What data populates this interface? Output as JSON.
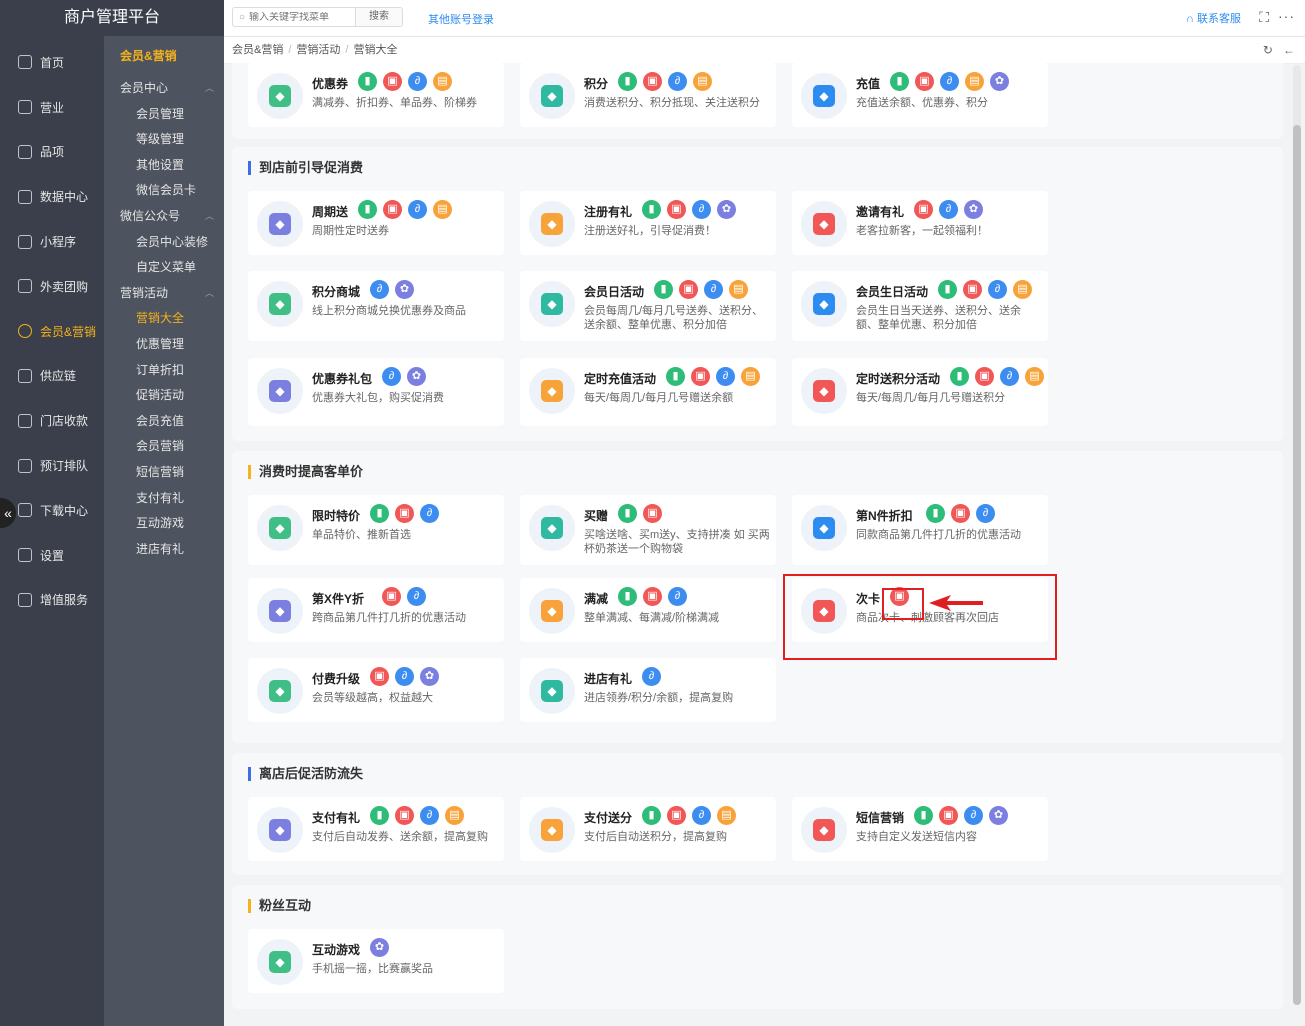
{
  "app_title": "商户管理平台",
  "nav1": [
    {
      "label": "首页",
      "icon": "home-icon"
    },
    {
      "label": "营业",
      "icon": "store-icon"
    },
    {
      "label": "品项",
      "icon": "product-icon"
    },
    {
      "label": "数据中心",
      "icon": "data-icon"
    },
    {
      "label": "小程序",
      "icon": "miniprogram-icon"
    },
    {
      "label": "外卖团购",
      "icon": "delivery-icon"
    },
    {
      "label": "会员&营销",
      "icon": "member-icon",
      "active": true
    },
    {
      "label": "供应链",
      "icon": "supply-icon"
    },
    {
      "label": "门店收款",
      "icon": "payment-icon"
    },
    {
      "label": "预订排队",
      "icon": "queue-icon"
    },
    {
      "label": "下载中心",
      "icon": "download-icon"
    },
    {
      "label": "设置",
      "icon": "settings-icon"
    },
    {
      "label": "增值服务",
      "icon": "value-service-icon"
    }
  ],
  "sidebar2": {
    "head": "会员&营销",
    "groups": [
      {
        "label": "会员中心",
        "items": [
          "会员管理",
          "等级管理",
          "其他设置",
          "微信会员卡"
        ]
      },
      {
        "label": "微信公众号",
        "items": [
          "会员中心装修",
          "自定义菜单"
        ]
      },
      {
        "label": "营销活动",
        "items": [
          "营销大全",
          "优惠管理",
          "订单折扣",
          "促销活动",
          "会员充值",
          "会员营销",
          "短信营销",
          "支付有礼",
          "互动游戏",
          "进店有礼"
        ]
      }
    ],
    "active_item": "营销大全"
  },
  "topbar": {
    "search_placeholder": "输入关键字找菜单",
    "search_button": "搜索",
    "other_login": "其他账号登录",
    "contact": "联系客服"
  },
  "breadcrumb": [
    "会员&营销",
    "营销活动",
    "营销大全"
  ],
  "sections": [
    {
      "title": "",
      "cards": [
        {
          "title": "优惠券",
          "desc": "满减券、折扣券、单品券、阶梯券",
          "badges": [
            "green",
            "red",
            "blue",
            "orange"
          ],
          "icon": "coupon-icon"
        },
        {
          "title": "积分",
          "desc": "消费送积分、积分抵现、关注送积分",
          "badges": [
            "green",
            "red",
            "blue",
            "orange"
          ],
          "icon": "points-icon"
        },
        {
          "title": "充值",
          "desc": "充值送余额、优惠券、积分",
          "badges": [
            "green",
            "red",
            "blue",
            "orange",
            "purple"
          ],
          "icon": "recharge-icon"
        }
      ]
    },
    {
      "title": "到店前引导促消费",
      "cards": [
        {
          "title": "周期送",
          "desc": "周期性定时送券",
          "badges": [
            "green",
            "red",
            "blue",
            "orange"
          ],
          "icon": "calendar-icon"
        },
        {
          "title": "注册有礼",
          "desc": "注册送好礼，引导促消费！",
          "badges": [
            "green",
            "red",
            "blue",
            "purple"
          ],
          "icon": "register-icon"
        },
        {
          "title": "邀请有礼",
          "desc": "老客拉新客，一起领福利！",
          "badges": [
            "red",
            "blue",
            "purple"
          ],
          "icon": "invite-icon"
        },
        {
          "title": "积分商城",
          "desc": "线上积分商城兑换优惠券及商品",
          "badges": [
            "blue",
            "purple"
          ],
          "icon": "mall-icon"
        },
        {
          "title": "会员日活动",
          "desc": "会员每周几/每月几号送券、送积分、送余额、整单优惠、积分加倍",
          "badges": [
            "green",
            "red",
            "blue",
            "orange"
          ],
          "icon": "crown-icon"
        },
        {
          "title": "会员生日活动",
          "desc": "会员生日当天送券、送积分、送余额、整单优惠、积分加倍",
          "badges": [
            "green",
            "red",
            "blue",
            "orange"
          ],
          "icon": "cake-icon"
        },
        {
          "title": "优惠券礼包",
          "desc": "优惠券大礼包，购买促消费",
          "badges": [
            "blue",
            "purple"
          ],
          "icon": "gift-icon"
        },
        {
          "title": "定时充值活动",
          "desc": "每天/每周几/每月几号赠送余额",
          "badges": [
            "green",
            "red",
            "blue",
            "orange"
          ],
          "icon": "alarm-icon"
        },
        {
          "title": "定时送积分活动",
          "desc": "每天/每周几/每月几号赠送积分",
          "badges": [
            "green",
            "red",
            "blue",
            "orange"
          ],
          "icon": "alarm-points-icon"
        }
      ]
    },
    {
      "title": "消费时提高客单价",
      "cards": [
        {
          "title": "限时特价",
          "desc": "单品特价、推新首选",
          "badges": [
            "green",
            "red",
            "blue"
          ],
          "icon": "clock-icon"
        },
        {
          "title": "买赠",
          "desc": "买啥送啥、买m送y、支持拼凑 如 买两杯奶茶送一个购物袋",
          "badges": [
            "green",
            "red"
          ],
          "icon": "buy-gift-icon"
        },
        {
          "title": "第N件折扣",
          "desc": "同款商品第几件打几折的优惠活动",
          "badges": [
            "green",
            "red",
            "blue"
          ],
          "icon": "percent-icon"
        },
        {
          "title": "第X件Y折",
          "desc": "跨商品第几件打几折的优惠活动",
          "badges": [
            "red",
            "blue"
          ],
          "icon": "discount-icon"
        },
        {
          "title": "满减",
          "desc": "整单满减、每满减/阶梯满减",
          "badges": [
            "green",
            "red",
            "blue"
          ],
          "icon": "full-reduce-icon"
        },
        {
          "title": "次卡",
          "desc": "商品次卡、刺激顾客再次回店",
          "badges": [
            "red"
          ],
          "icon": "card-icon"
        },
        {
          "title": "付费升级",
          "desc": "会员等级越高，权益越大",
          "badges": [
            "red",
            "blue",
            "purple"
          ],
          "icon": "upgrade-icon"
        },
        {
          "title": "进店有礼",
          "desc": "进店领券/积分/余额，提高复购",
          "badges": [
            "blue"
          ],
          "icon": "fire-icon"
        }
      ]
    },
    {
      "title": "离店后促活防流失",
      "cards": [
        {
          "title": "支付有礼",
          "desc": "支付后自动发券、送余额，提高复购",
          "badges": [
            "green",
            "red",
            "blue",
            "orange"
          ],
          "icon": "pay-gift-icon"
        },
        {
          "title": "支付送分",
          "desc": "支付后自动送积分，提高复购",
          "badges": [
            "green",
            "red",
            "blue",
            "orange"
          ],
          "icon": "coins-icon"
        },
        {
          "title": "短信营销",
          "desc": "支持自定义发送短信内容",
          "badges": [
            "green",
            "red",
            "blue",
            "purple"
          ],
          "icon": "sms-icon"
        }
      ]
    },
    {
      "title": "粉丝互动",
      "cards": [
        {
          "title": "互动游戏",
          "desc": "手机摇一摇，比赛赢奖品",
          "badges": [
            "purple"
          ],
          "icon": "gamepad-icon"
        }
      ]
    }
  ],
  "colors": {
    "sidebar": "#3a3f4b",
    "sidebar2": "#4d535f",
    "accent": "#f5b21b",
    "link": "#2d8cf0",
    "highlight": "#e02020"
  }
}
